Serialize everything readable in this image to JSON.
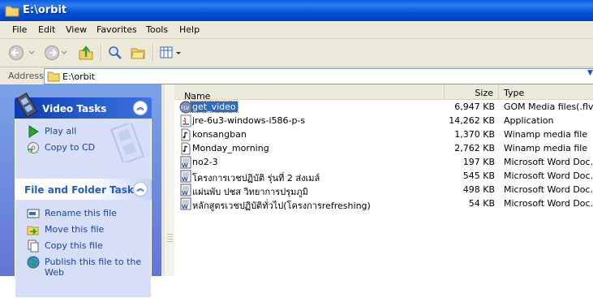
{
  "window": {
    "title": "E:\\orbit"
  },
  "menu": [
    "File",
    "Edit",
    "View",
    "Favorites",
    "Tools",
    "Help"
  ],
  "toolbar": {
    "back_icon": "back-arrow-icon",
    "forward_icon": "forward-arrow-icon",
    "up_icon": "up-folder-icon",
    "search_icon": "search-icon",
    "folders_icon": "folders-icon",
    "views_icon": "views-icon"
  },
  "address": {
    "label": "Address",
    "value": "E:\\orbit"
  },
  "video_tasks": {
    "title": "Video Tasks",
    "items": [
      {
        "label": "Play all",
        "icon": "play-icon"
      },
      {
        "label": "Copy to CD",
        "icon": "copy-to-cd-icon"
      }
    ]
  },
  "file_tasks": {
    "title": "File and Folder Tasks",
    "items": [
      {
        "label": "Rename this file",
        "icon": "rename-icon"
      },
      {
        "label": "Move this file",
        "icon": "move-icon"
      },
      {
        "label": "Copy this file",
        "icon": "copy-icon"
      },
      {
        "label": "Publish this file to the",
        "label2": "Web",
        "icon": "publish-web-icon"
      }
    ]
  },
  "columns": {
    "name": "Name",
    "size": "Size",
    "type": "Type"
  },
  "files": [
    {
      "name": "get_video",
      "size": "6,947 KB",
      "type": "GOM Media files(.flv)",
      "icon": "flv-file-icon",
      "selected": true
    },
    {
      "name": "jre-6u3-windows-i586-p-s",
      "size": "14,262 KB",
      "type": "Application",
      "icon": "java-installer-icon"
    },
    {
      "name": "konsangban",
      "size": "1,370 KB",
      "type": "Winamp media file",
      "icon": "winamp-file-icon"
    },
    {
      "name": "Monday_morning",
      "size": "2,762 KB",
      "type": "Winamp media file",
      "icon": "winamp-file-icon"
    },
    {
      "name": "no2-3",
      "size": "197 KB",
      "type": "Microsoft Word Doc...",
      "icon": "word-doc-icon"
    },
    {
      "name": "โครงการเวชปฏิบัติ รุ่นที่ 2 ส่งเมล์",
      "size": "545 KB",
      "type": "Microsoft Word Doc...",
      "icon": "word-doc-icon"
    },
    {
      "name": "แผ่นพับ ปชส วิทยาการปรุมภูมิ",
      "size": "498 KB",
      "type": "Microsoft Word Doc...",
      "icon": "word-doc-icon"
    },
    {
      "name": "หลักสูตรเวชปฏิบัติทั่วไป(โครงการrefreshing)",
      "size": "54 KB",
      "type": "Microsoft Word Doc...",
      "icon": "word-doc-icon"
    }
  ]
}
